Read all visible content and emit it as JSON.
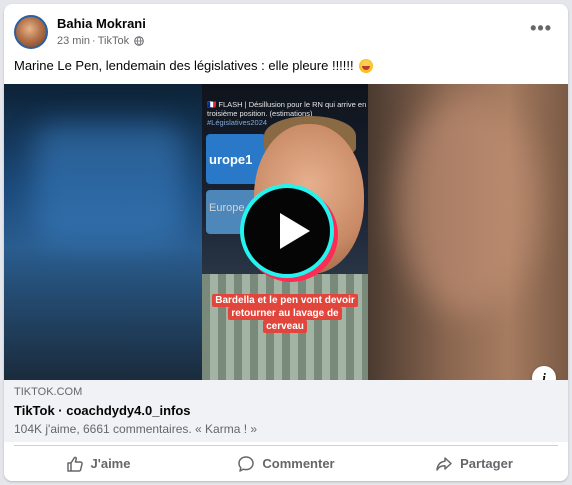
{
  "post": {
    "author": "Bahia Mokrani",
    "time": "23 min",
    "separator": "·",
    "source": "TikTok",
    "privacy_icon": "globe-icon",
    "more_icon": "more-options-icon",
    "more_label": "•••",
    "caption": "Marine Le Pen, lendemain des législatives : elle pleure !!!!!!"
  },
  "video": {
    "flash_text": "🇫🇷 FLASH | Désillusion pour le RN qui arrive en troisième position. (estimations)",
    "flash_tag": "#Législatives2024",
    "europe1_label": "urope1",
    "europe1b_label": "Europe 1",
    "subtitle": "Bardella et le pen vont devoir retourner au lavage de cerveau",
    "play_icon": "play-icon",
    "info_label": "i"
  },
  "link": {
    "domain": "TIKTOK.COM",
    "title": "TikTok · coachdydy4.0_infos",
    "description": "104K j'aime, 6661 commentaires. « Karma ! »"
  },
  "actions": {
    "like": "J'aime",
    "comment": "Commenter",
    "share": "Partager"
  },
  "colors": {
    "secondary_text": "#65676b",
    "link_bg": "#f0f2f5",
    "tiktok_cyan": "#25f4ee",
    "tiktok_red": "#fe2c55"
  }
}
